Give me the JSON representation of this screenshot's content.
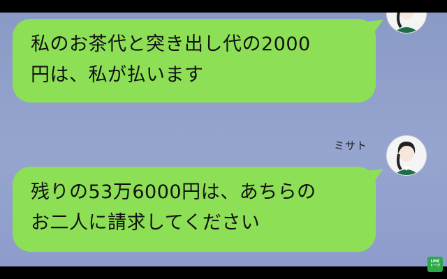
{
  "messages": [
    {
      "text_line1": "私のお茶代と突き出し代の2000",
      "text_line2": "円は、私が払います"
    },
    {
      "sender": "ミサト",
      "text_line1": "残りの53万6000円は、あちらの",
      "text_line2": "お二人に請求してください"
    }
  ],
  "logo": {
    "line1": "LINE",
    "line2": "トーク"
  },
  "colors": {
    "bubble": "#8de055",
    "background": "#8a9ac6",
    "letterbox": "#000000"
  }
}
